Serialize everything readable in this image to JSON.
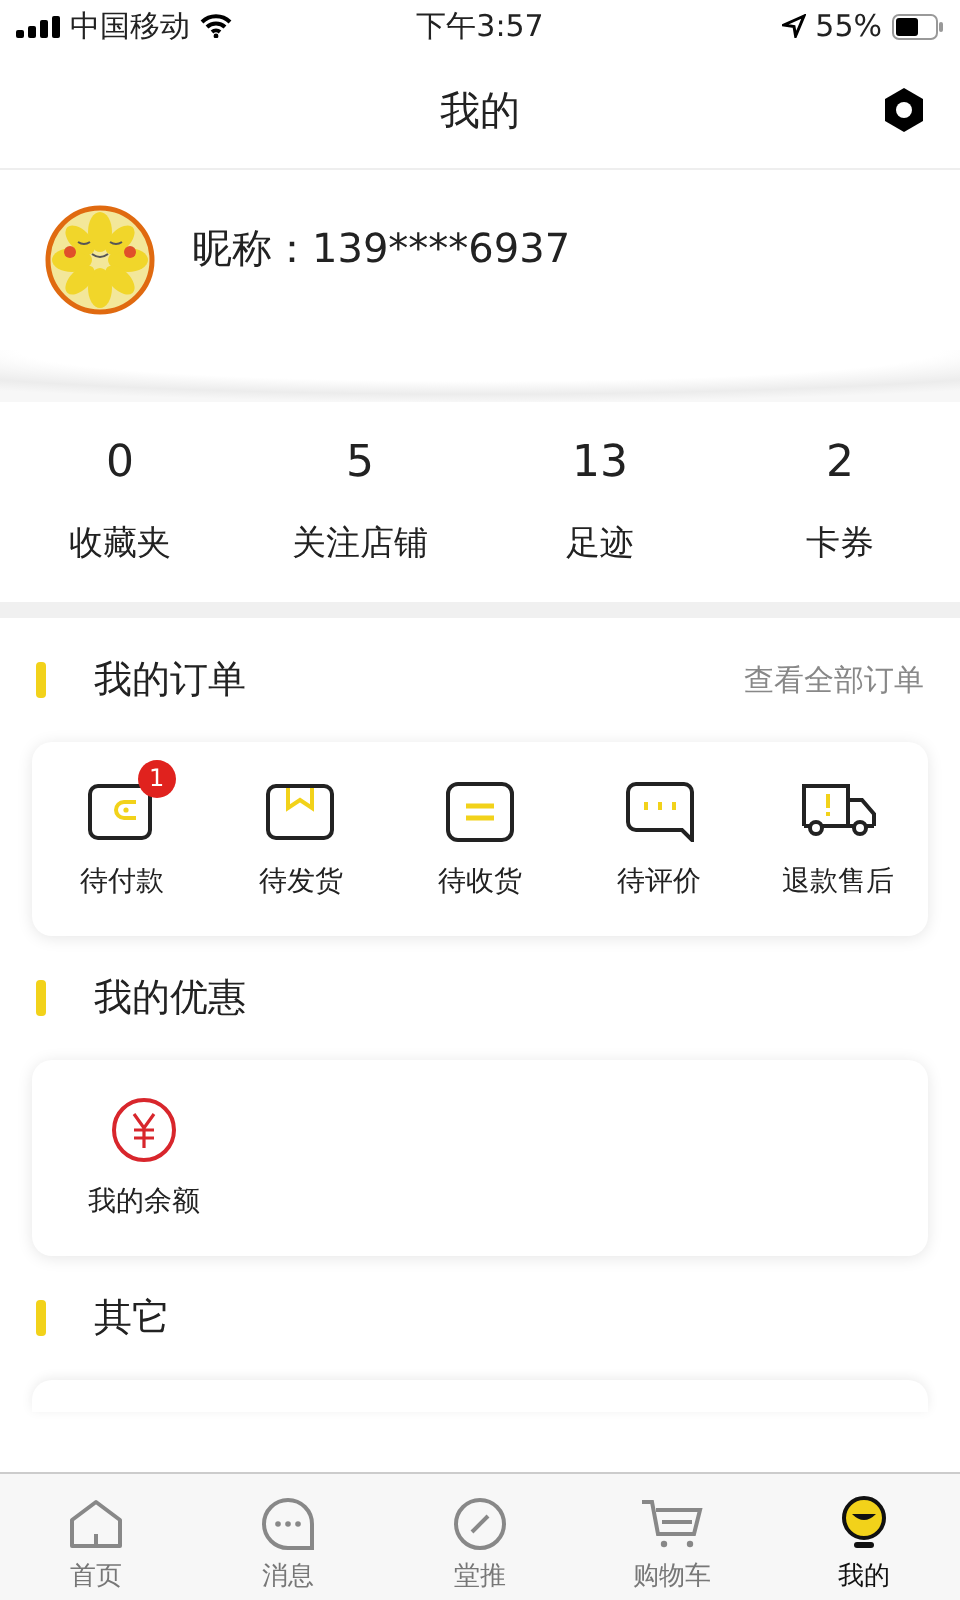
{
  "status_bar": {
    "carrier": "中国移动",
    "time": "下午3:57",
    "battery": "55%"
  },
  "nav": {
    "title": "我的"
  },
  "profile": {
    "nickname": "昵称：139****6937"
  },
  "stats": [
    {
      "value": "0",
      "label": "收藏夹"
    },
    {
      "value": "5",
      "label": "关注店铺"
    },
    {
      "value": "13",
      "label": "足迹"
    },
    {
      "value": "2",
      "label": "卡券"
    }
  ],
  "orders": {
    "title": "我的订单",
    "link": "查看全部订单",
    "items": [
      {
        "kind": "wallet",
        "label": "待付款",
        "badge": "1"
      },
      {
        "kind": "box",
        "label": "待发货"
      },
      {
        "kind": "receive",
        "label": "待收货"
      },
      {
        "kind": "comment",
        "label": "待评价"
      },
      {
        "kind": "truck",
        "label": "退款售后"
      }
    ]
  },
  "benefits": {
    "title": "我的优惠",
    "items": [
      {
        "label": "我的余额"
      }
    ]
  },
  "other": {
    "title": "其它"
  },
  "tabbar": [
    {
      "kind": "home",
      "label": "首页",
      "selected": false
    },
    {
      "kind": "message",
      "label": "消息",
      "selected": false
    },
    {
      "kind": "compass",
      "label": "堂推",
      "selected": false
    },
    {
      "kind": "cart",
      "label": "购物车",
      "selected": false
    },
    {
      "kind": "me",
      "label": "我的",
      "selected": true
    }
  ]
}
